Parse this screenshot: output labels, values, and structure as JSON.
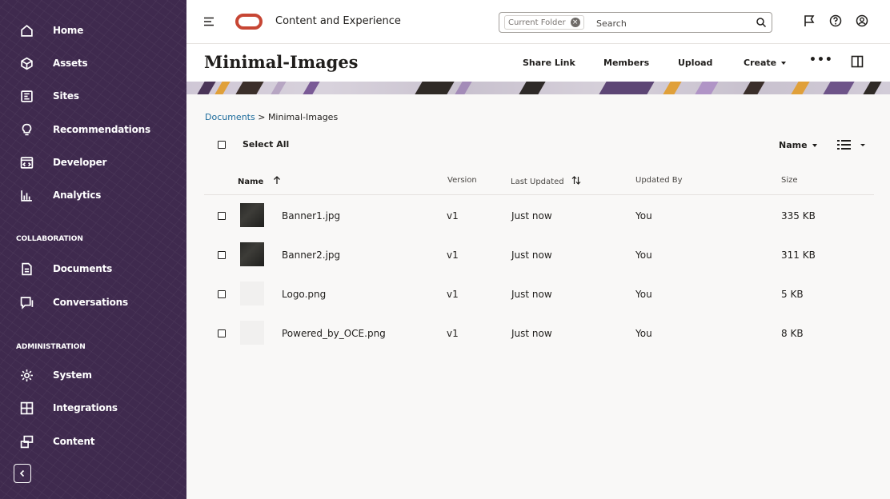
{
  "app": {
    "title": "Content and Experience"
  },
  "search": {
    "scope_chip": "Current Folder",
    "placeholder": "Search"
  },
  "sidebar": {
    "items_top": [
      {
        "label": "Home",
        "icon": "home-icon"
      },
      {
        "label": "Assets",
        "icon": "cube-icon"
      },
      {
        "label": "Sites",
        "icon": "sites-icon"
      },
      {
        "label": "Recommendations",
        "icon": "lightbulb-icon"
      },
      {
        "label": "Developer",
        "icon": "code-icon"
      },
      {
        "label": "Analytics",
        "icon": "chart-icon"
      }
    ],
    "section_collab": "COLLABORATION",
    "items_collab": [
      {
        "label": "Documents",
        "icon": "document-icon"
      },
      {
        "label": "Conversations",
        "icon": "conversation-icon"
      }
    ],
    "section_admin": "ADMINISTRATION",
    "items_admin": [
      {
        "label": "System",
        "icon": "gear-icon"
      },
      {
        "label": "Integrations",
        "icon": "integrations-icon"
      },
      {
        "label": "Content",
        "icon": "content-icon"
      }
    ]
  },
  "page": {
    "title": "Minimal-Images",
    "actions": {
      "share_link": "Share Link",
      "members": "Members",
      "upload": "Upload",
      "create": "Create"
    }
  },
  "breadcrumb": {
    "root": "Documents",
    "separator": " > ",
    "current": "Minimal-Images"
  },
  "toolbar": {
    "select_all": "Select All",
    "sort_by": "Name"
  },
  "table": {
    "columns": {
      "name": "Name",
      "version": "Version",
      "last_updated": "Last Updated",
      "updated_by": "Updated By",
      "size": "Size"
    },
    "rows": [
      {
        "name": "Banner1.jpg",
        "version": "v1",
        "last_updated": "Just now",
        "updated_by": "You",
        "size": "335 KB",
        "thumb": "dark"
      },
      {
        "name": "Banner2.jpg",
        "version": "v1",
        "last_updated": "Just now",
        "updated_by": "You",
        "size": "311 KB",
        "thumb": "dark"
      },
      {
        "name": "Logo.png",
        "version": "v1",
        "last_updated": "Just now",
        "updated_by": "You",
        "size": "5 KB",
        "thumb": "light"
      },
      {
        "name": "Powered_by_OCE.png",
        "version": "v1",
        "last_updated": "Just now",
        "updated_by": "You",
        "size": "8 KB",
        "thumb": "light"
      }
    ]
  },
  "colors": {
    "sidebar_bg": "#3f2a4e",
    "oracle_red": "#c74634",
    "link_blue": "#1c6b9b"
  }
}
